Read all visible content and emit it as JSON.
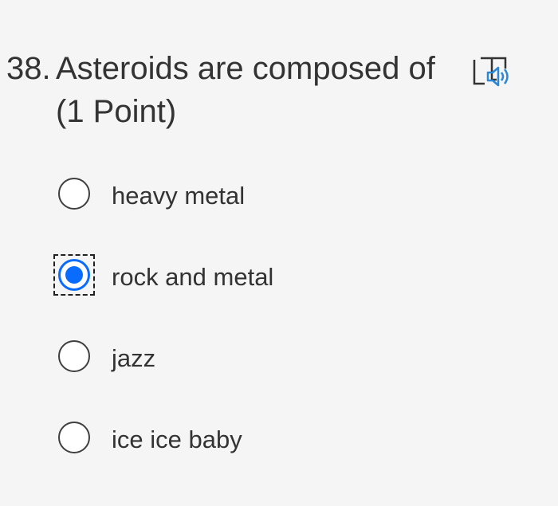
{
  "question": {
    "number": "38.",
    "title": "Asteroids are composed of",
    "points": "(1 Point)",
    "reader_icon": "immersive-reader-icon",
    "options": [
      {
        "label": "heavy metal",
        "selected": false
      },
      {
        "label": "rock and metal",
        "selected": true
      },
      {
        "label": "jazz",
        "selected": false
      },
      {
        "label": "ice ice baby",
        "selected": false
      }
    ]
  },
  "colors": {
    "accent": "#0a6cff",
    "text": "#333333",
    "background": "#f5f5f5"
  }
}
